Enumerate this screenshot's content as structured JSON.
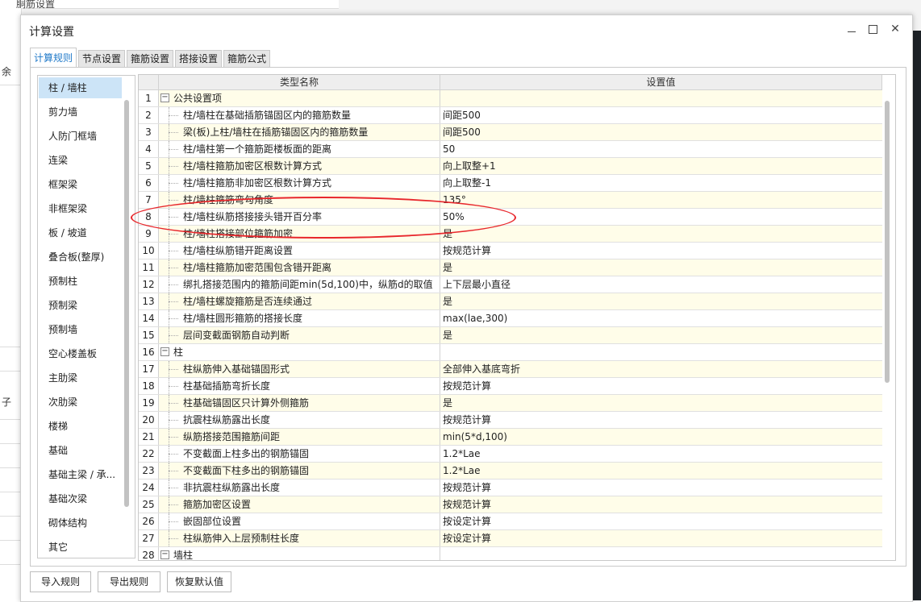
{
  "background_app": {
    "top_label": "胴筋设置",
    "left_labels": [
      "余",
      "子"
    ]
  },
  "dialog": {
    "title": "计算设置",
    "tabs": [
      {
        "label": "计算规则",
        "active": true
      },
      {
        "label": "节点设置",
        "active": false
      },
      {
        "label": "箍筋设置",
        "active": false
      },
      {
        "label": "搭接设置",
        "active": false
      },
      {
        "label": "箍筋公式",
        "active": false
      }
    ],
    "categories": [
      "柱 / 墙柱",
      "剪力墙",
      "人防门框墙",
      "连梁",
      "框架梁",
      "非框架梁",
      "板 / 坡道",
      "叠合板(整厚)",
      "预制柱",
      "预制梁",
      "预制墙",
      "空心楼盖板",
      "主肋梁",
      "次肋梁",
      "楼梯",
      "基础",
      "基础主梁 / 承...",
      "基础次梁",
      "砌体结构",
      "其它"
    ],
    "selected_category": "柱 / 墙柱",
    "grid": {
      "headers": [
        "类型名称",
        "设置值"
      ],
      "rows": [
        {
          "num": "1",
          "name": "公共设置项",
          "value": "",
          "group": true,
          "toggle": "−"
        },
        {
          "num": "2",
          "name": "柱/墙柱在基础插筋锚固区内的箍筋数量",
          "value": "间距500"
        },
        {
          "num": "3",
          "name": "梁(板)上柱/墙柱在插筋锚固区内的箍筋数量",
          "value": "间距500"
        },
        {
          "num": "4",
          "name": "柱/墙柱第一个箍筋距楼板面的距离",
          "value": "50"
        },
        {
          "num": "5",
          "name": "柱/墙柱箍筋加密区根数计算方式",
          "value": "向上取整+1"
        },
        {
          "num": "6",
          "name": "柱/墙柱箍筋非加密区根数计算方式",
          "value": "向上取整-1"
        },
        {
          "num": "7",
          "name": "柱/墙柱箍筋弯勾角度",
          "value": "135°"
        },
        {
          "num": "8",
          "name": "柱/墙柱纵筋搭接接头错开百分率",
          "value": "50%"
        },
        {
          "num": "9",
          "name": "柱/墙柱搭接部位箍筋加密",
          "value": "是"
        },
        {
          "num": "10",
          "name": "柱/墙柱纵筋错开距离设置",
          "value": "按规范计算"
        },
        {
          "num": "11",
          "name": "柱/墙柱箍筋加密范围包含错开距离",
          "value": "是"
        },
        {
          "num": "12",
          "name": "绑扎搭接范围内的箍筋间距min(5d,100)中，纵筋d的取值",
          "value": "上下层最小直径"
        },
        {
          "num": "13",
          "name": "柱/墙柱螺旋箍筋是否连续通过",
          "value": "是"
        },
        {
          "num": "14",
          "name": "柱/墙柱圆形箍筋的搭接长度",
          "value": "max(lae,300)"
        },
        {
          "num": "15",
          "name": "层间变截面钢筋自动判断",
          "value": "是"
        },
        {
          "num": "16",
          "name": "柱",
          "value": "",
          "group": true,
          "toggle": "−"
        },
        {
          "num": "17",
          "name": "柱纵筋伸入基础锚固形式",
          "value": "全部伸入基底弯折"
        },
        {
          "num": "18",
          "name": "柱基础插筋弯折长度",
          "value": "按规范计算"
        },
        {
          "num": "19",
          "name": "柱基础锚固区只计算外侧箍筋",
          "value": "是"
        },
        {
          "num": "20",
          "name": "抗震柱纵筋露出长度",
          "value": "按规范计算"
        },
        {
          "num": "21",
          "name": "纵筋搭接范围箍筋间距",
          "value": "min(5*d,100)"
        },
        {
          "num": "22",
          "name": "不变截面上柱多出的钢筋锚固",
          "value": "1.2*Lae"
        },
        {
          "num": "23",
          "name": "不变截面下柱多出的钢筋锚固",
          "value": "1.2*Lae"
        },
        {
          "num": "24",
          "name": "非抗震柱纵筋露出长度",
          "value": "按规范计算"
        },
        {
          "num": "25",
          "name": "箍筋加密区设置",
          "value": "按规范计算"
        },
        {
          "num": "26",
          "name": "嵌固部位设置",
          "value": "按设定计算"
        },
        {
          "num": "27",
          "name": "柱纵筋伸入上层预制柱长度",
          "value": "按设定计算"
        },
        {
          "num": "28",
          "name": "墙柱",
          "value": "",
          "group": true,
          "toggle": "−"
        }
      ]
    },
    "buttons": {
      "import_label": "导入规则",
      "export_label": "导出规则",
      "restore_label": "恢复默认值"
    }
  },
  "colors": {
    "accent": "#1e78c8",
    "selected_bg": "#cce4f7",
    "annotation": "#e8272c",
    "odd_row": "#fffde9"
  }
}
